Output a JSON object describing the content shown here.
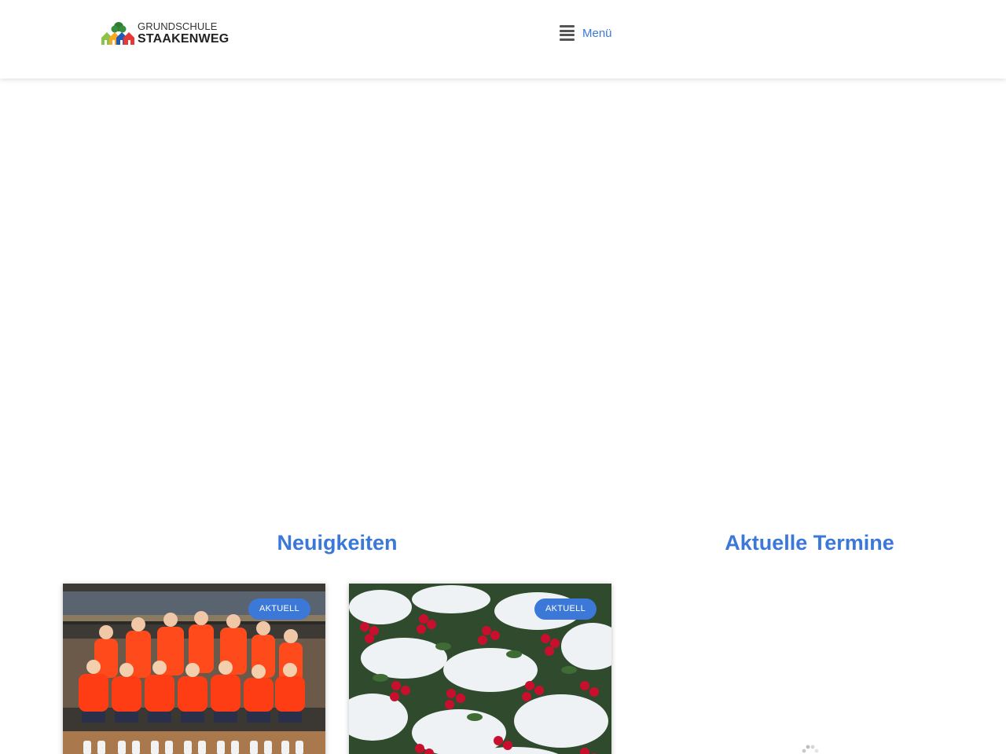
{
  "header": {
    "logo": {
      "line1": "GRUNDSCHULE",
      "line2": "STAAKENWEG",
      "icon": "school-houses-logo"
    },
    "menu": {
      "icon": "hamburger-icon",
      "label": "Menü"
    }
  },
  "sections": {
    "news": {
      "title": "Neuigkeiten",
      "cards": [
        {
          "badge": "AKTUELL",
          "image": "team-photo-orange-shirts"
        },
        {
          "badge": "AKTUELL",
          "image": "snowy-red-berries"
        }
      ]
    },
    "events": {
      "title": "Aktuelle Termine",
      "loading_icon": "spinner-icon"
    }
  },
  "colors": {
    "accent": "#3b78d8",
    "header_bg": "#ffffff",
    "badge_bg": "#3b78d8"
  }
}
